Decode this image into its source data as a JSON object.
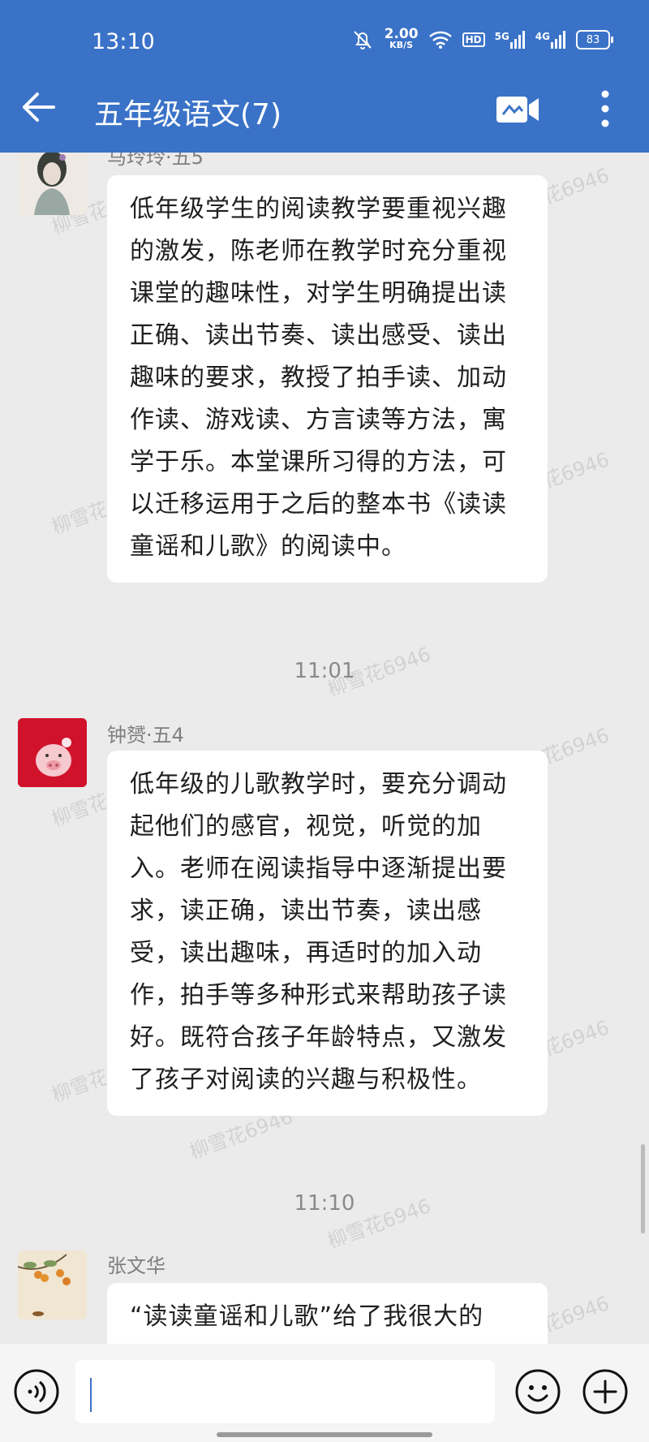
{
  "status_bar": {
    "time": "13:10",
    "net_speed_value": "2.00",
    "net_speed_unit": "KB/S",
    "hd_label": "HD",
    "signal_5g": "5G",
    "signal_4g": "4G",
    "battery": "83"
  },
  "header": {
    "title": "五年级语文(7)",
    "bg_color": "#3a72c8"
  },
  "messages": [
    {
      "sender": "马玲玲·五5",
      "text": "低年级学生的阅读教学要重视兴趣的激发，陈老师在教学时充分重视课堂的趣味性，对学生明确提出读正确、读出节奏、读出感受、读出趣味的要求，教授了拍手读、加动作读、游戏读、方言读等方法，寓学于乐。本堂课所习得的方法，可以迁移运用于之后的整本书《读读童谣和儿歌》的阅读中。"
    },
    {
      "time": "11:01",
      "sender": "钟赟·五4",
      "text": "低年级的儿歌教学时，要充分调动起他们的感官，视觉，听觉的加入。老师在阅读指导中逐渐提出要求，读正确，读出节奏，读出感受，读出趣味，再适时的加入动作，拍手等多种形式来帮助孩子读好。既符合孩子年龄特点，又激发了孩子对阅读的兴趣与积极性。"
    },
    {
      "time": "11:10",
      "sender": "张文华",
      "text": "“读读童谣和儿歌”给了我很大的"
    }
  ],
  "watermark_text": "柳雪花6946",
  "input": {
    "placeholder": ""
  }
}
